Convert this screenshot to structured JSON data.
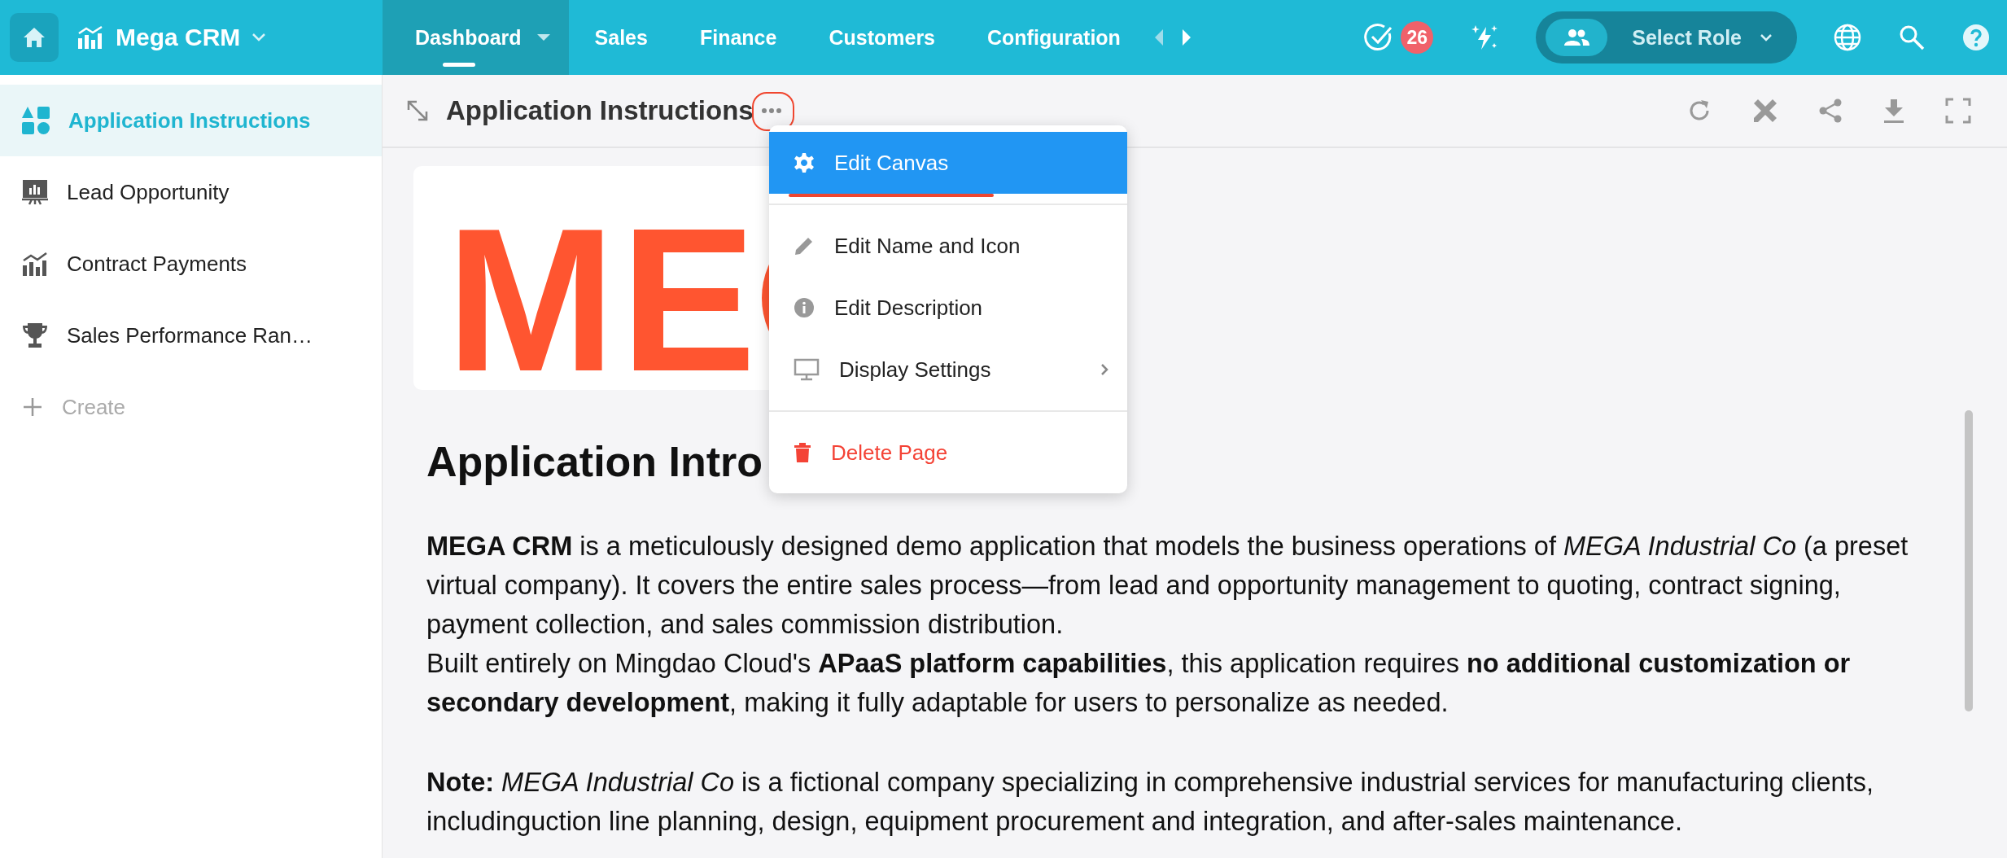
{
  "app": {
    "name": "Mega CRM"
  },
  "nav": {
    "items": [
      {
        "label": "Dashboard",
        "selected": true,
        "dropdown": true
      },
      {
        "label": "Sales",
        "selected": false,
        "dropdown": false
      },
      {
        "label": "Finance",
        "selected": false,
        "dropdown": false
      },
      {
        "label": "Customers",
        "selected": false,
        "dropdown": false
      },
      {
        "label": "Configuration",
        "selected": false,
        "dropdown": false
      }
    ]
  },
  "tasks": {
    "count": "26"
  },
  "role": {
    "label": "Select Role"
  },
  "sidebar": {
    "items": [
      {
        "label": "Application Instructions",
        "kind": "shapes",
        "selected": true
      },
      {
        "label": "Lead Opportunity",
        "kind": "board",
        "selected": false
      },
      {
        "label": "Contract Payments",
        "kind": "chart",
        "selected": false
      },
      {
        "label": "Sales Performance Ran…",
        "kind": "trophy",
        "selected": false
      }
    ],
    "create": "Create"
  },
  "page": {
    "title": "Application Instructions",
    "logo": "ME",
    "heading": "Application Intro",
    "paragraphs": [
      [
        "**MEGA CRM** is a meticulously designed demo application that models the business operations of *MEGA Industrial Co* (a preset virtual company). It covers the entire sales process—from lead and opportunity management to quoting, contract signing, payment collection, and sales commission distribution.",
        "Built entirely on Mingdao Cloud's **APaaS platform capabilities**, this application requires **no additional customization or secondary development**, making it fully adaptable for users to personalize as needed."
      ],
      [
        "**Note:** *MEGA Industrial Co* is a fictional company specializing in comprehensive industrial services for manufacturing clients, includinguction line planning, design, equipment procurement and integration, and after-sales maintenance."
      ]
    ]
  },
  "menu": {
    "groups": [
      [
        {
          "label": "Edit Canvas",
          "kind": "gear",
          "selected": true,
          "submenu": false,
          "danger": false
        }
      ],
      [
        {
          "label": "Edit Name and Icon",
          "kind": "pencil",
          "selected": false,
          "submenu": false,
          "danger": false
        },
        {
          "label": "Edit Description",
          "kind": "info",
          "selected": false,
          "submenu": false,
          "danger": false
        },
        {
          "label": "Display Settings",
          "kind": "monitor",
          "selected": false,
          "submenu": true,
          "danger": false
        }
      ],
      [
        {
          "label": "Delete Page",
          "kind": "trash",
          "selected": false,
          "submenu": false,
          "danger": true
        }
      ]
    ]
  }
}
